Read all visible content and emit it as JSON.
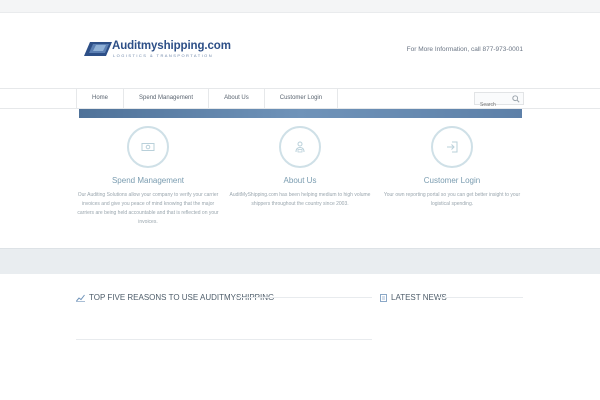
{
  "header": {
    "logo_text": "Auditmyshipping.com",
    "logo_tagline": "LOGISTICS & TRANSPORTATION",
    "info": "For More Information, call 877-973-0001"
  },
  "nav": {
    "items": [
      {
        "label": "Home"
      },
      {
        "label": "Spend Management"
      },
      {
        "label": "About Us"
      },
      {
        "label": "Customer Login"
      }
    ],
    "search_placeholder": "Search"
  },
  "features": [
    {
      "title": "Spend Management",
      "icon": "money-icon",
      "desc": "Our Auditing Solutions allow your company to verify your carrier invoices and give you peace of mind knowing that the major carriers are being held accountable and that is reflected on your invoices."
    },
    {
      "title": "About Us",
      "icon": "people-icon",
      "desc": "AuditMyShipping.com has been helping medium to high volume shippers throughout the country since 2003."
    },
    {
      "title": "Customer Login",
      "icon": "login-icon",
      "desc": "Your own reporting portal so you can get better insight to your logistical spending."
    }
  ],
  "sections": {
    "reasons_title": "TOP FIVE REASONS TO USE AUDITMYSHIPPING",
    "news_title": "LATEST NEWS"
  },
  "colors": {
    "brand": "#2d4f87",
    "accent": "#7a9cb0",
    "slider": "#6f93b9"
  }
}
